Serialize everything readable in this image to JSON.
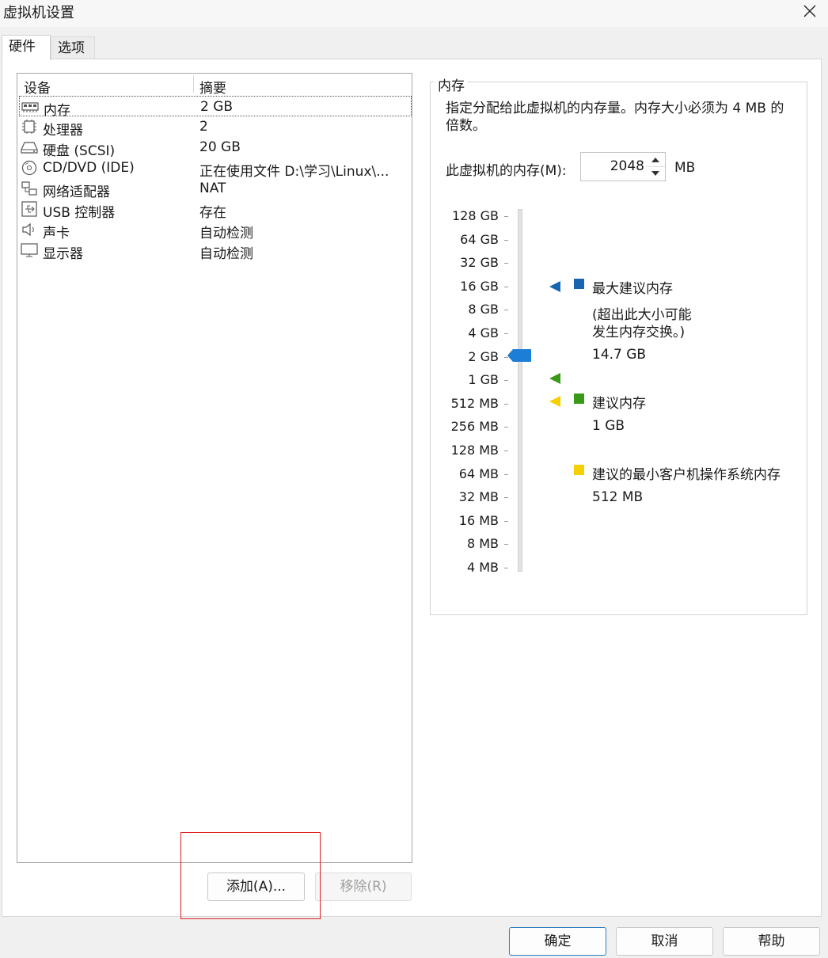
{
  "window": {
    "title": "虚拟机设置"
  },
  "tabs": [
    {
      "label": "硬件"
    },
    {
      "label": "选项"
    }
  ],
  "devices": {
    "col_device": "设备",
    "col_summary": "摘要",
    "items": [
      {
        "name": "内存",
        "summary": "2 GB",
        "icon": "memory-icon"
      },
      {
        "name": "处理器",
        "summary": "2",
        "icon": "processor-icon"
      },
      {
        "name": "硬盘 (SCSI)",
        "summary": "20 GB",
        "icon": "hard-disk-icon"
      },
      {
        "name": "CD/DVD (IDE)",
        "summary": "正在使用文件 D:\\学习\\Linux\\...",
        "icon": "cd-dvd-icon"
      },
      {
        "name": "网络适配器",
        "summary": "NAT",
        "icon": "network-adapter-icon"
      },
      {
        "name": "USB 控制器",
        "summary": "存在",
        "icon": "usb-icon"
      },
      {
        "name": "声卡",
        "summary": "自动检测",
        "icon": "speaker-icon"
      },
      {
        "name": "显示器",
        "summary": "自动检测",
        "icon": "monitor-icon"
      }
    ],
    "selected_index": 0
  },
  "buttons": {
    "add": "添加(A)...",
    "remove": "移除(R)",
    "ok": "确定",
    "cancel": "取消",
    "help": "帮助"
  },
  "memory": {
    "group_title": "内存",
    "description": "指定分配给此虚拟机的内存量。内存大小必须为 4 MB 的倍数。",
    "field_label": "此虚拟机的内存(M):",
    "value": "2048",
    "unit": "MB",
    "scale_labels": [
      "128 GB",
      "64 GB",
      "32 GB",
      "16 GB",
      "8 GB",
      "4 GB",
      "2 GB",
      "1 GB",
      "512 MB",
      "256 MB",
      "128 MB",
      "64 MB",
      "32 MB",
      "16 MB",
      "8 MB",
      "4 MB"
    ],
    "slider_value": "2 GB",
    "legend": {
      "max_label": "最大建议内存",
      "max_note_line1": "(超出此大小可能",
      "max_note_line2": "发生内存交换。)",
      "max_value": "14.7 GB",
      "rec_label": "建议内存",
      "rec_value": "1 GB",
      "min_label": "建议的最小客户机操作系统内存",
      "min_value": "512 MB"
    },
    "colors": {
      "max": "#1765b0",
      "recommended": "#3a9a18",
      "minimum": "#f4d000",
      "thumb": "#1c7ed6"
    }
  }
}
